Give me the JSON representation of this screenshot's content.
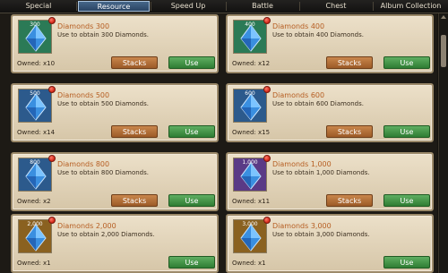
{
  "tabs": [
    {
      "label": "Special",
      "active": false
    },
    {
      "label": "Resource",
      "active": true
    },
    {
      "label": "Speed Up",
      "active": false
    },
    {
      "label": "Battle",
      "active": false
    },
    {
      "label": "Chest",
      "active": false
    },
    {
      "label": "Album Collection",
      "active": false
    }
  ],
  "items": [
    {
      "qty": "300",
      "name": "Diamonds 300",
      "desc": "Use to obtain 300 Diamonds.",
      "owned": "Owned: x10",
      "stacks_label": "Stacks",
      "use_label": "Use",
      "frame_color": "#2b7a56",
      "gem": "diamond-blue-icon"
    },
    {
      "qty": "400",
      "name": "Diamonds 400",
      "desc": "Use to obtain 400 Diamonds.",
      "owned": "Owned: x12",
      "stacks_label": "Stacks",
      "use_label": "Use",
      "frame_color": "#2b7a56",
      "gem": "diamond-blue-icon"
    },
    {
      "qty": "500",
      "name": "Diamonds 500",
      "desc": "Use to obtain 500 Diamonds.",
      "owned": "Owned: x14",
      "stacks_label": "Stacks",
      "use_label": "Use",
      "frame_color": "#2c5a8c",
      "gem": "diamond-blue-icon"
    },
    {
      "qty": "600",
      "name": "Diamonds 600",
      "desc": "Use to obtain 600 Diamonds.",
      "owned": "Owned: x15",
      "stacks_label": "Stacks",
      "use_label": "Use",
      "frame_color": "#2c5a8c",
      "gem": "diamond-blue-icon"
    },
    {
      "qty": "800",
      "name": "Diamonds 800",
      "desc": "Use to obtain 800 Diamonds.",
      "owned": "Owned: x2",
      "stacks_label": "Stacks",
      "use_label": "Use",
      "frame_color": "#2c5a8c",
      "gem": "diamond-blue-icon"
    },
    {
      "qty": "1,000",
      "name": "Diamonds 1,000",
      "desc": "Use to obtain 1,000 Diamonds.",
      "owned": "Owned: x11",
      "stacks_label": "Stacks",
      "use_label": "Use",
      "frame_color": "#5a3a86",
      "gem": "diamond-blue-icon"
    },
    {
      "qty": "2,000",
      "name": "Diamonds 2,000",
      "desc": "Use to obtain 2,000 Diamonds.",
      "owned": "Owned: x1",
      "stacks_label": "",
      "use_label": "Use",
      "frame_color": "#8a6120",
      "gem": "diamond-blue-icon"
    },
    {
      "qty": "3,000",
      "name": "Diamonds 3,000",
      "desc": "Use to obtain 3,000 Diamonds.",
      "owned": "Owned: x1",
      "stacks_label": "",
      "use_label": "Use",
      "frame_color": "#8a6120",
      "gem": "diamond-blue-icon"
    }
  ]
}
